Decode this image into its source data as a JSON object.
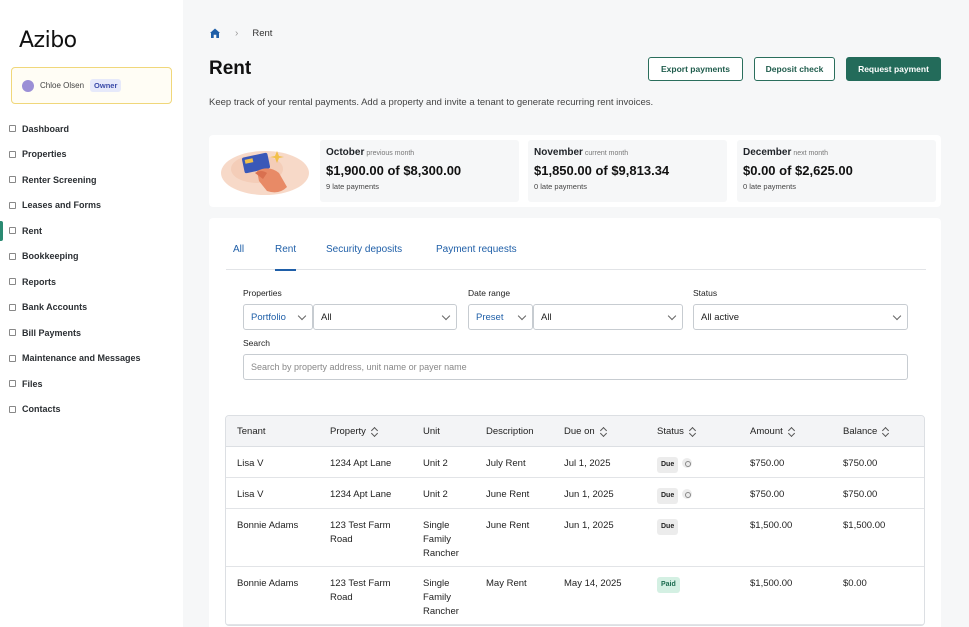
{
  "brand": {
    "logo": "Azibo"
  },
  "user": {
    "name": "Chloe Olsen",
    "role": "Owner"
  },
  "sidebar": {
    "items": [
      {
        "label": "Dashboard",
        "icon": "home-icon"
      },
      {
        "label": "Properties",
        "icon": "building-icon"
      },
      {
        "label": "Renter Screening",
        "icon": "screening-icon"
      },
      {
        "label": "Leases and Forms",
        "icon": "document-icon"
      },
      {
        "label": "Rent",
        "icon": "rent-icon",
        "active": true
      },
      {
        "label": "Bookkeeping",
        "icon": "ledger-icon"
      },
      {
        "label": "Reports",
        "icon": "report-icon"
      },
      {
        "label": "Bank Accounts",
        "icon": "bank-icon"
      },
      {
        "label": "Bill Payments",
        "icon": "bill-icon"
      },
      {
        "label": "Maintenance and Messages",
        "icon": "wrench-icon"
      },
      {
        "label": "Files",
        "icon": "folder-icon"
      },
      {
        "label": "Contacts",
        "icon": "contacts-icon"
      }
    ]
  },
  "breadcrumb": {
    "current": "Rent"
  },
  "header": {
    "title": "Rent",
    "subtitle": "Keep track of your rental payments. Add a property and invite a tenant to generate recurring rent invoices.",
    "export_label": "Export payments",
    "deposit_label": "Deposit check",
    "request_label": "Request payment"
  },
  "summary": [
    {
      "month": "October",
      "tag": "previous month",
      "amount": "$1,900.00 of $8,300.00",
      "late": "9 late payments"
    },
    {
      "month": "November",
      "tag": "current month",
      "amount": "$1,850.00 of $9,813.34",
      "late": "0 late payments"
    },
    {
      "month": "December",
      "tag": "next month",
      "amount": "$0.00 of $2,625.00",
      "late": "0 late payments"
    }
  ],
  "tabs": {
    "all": "All",
    "rent": "Rent",
    "security": "Security deposits",
    "payment_requests": "Payment requests"
  },
  "filters": {
    "properties_label": "Properties",
    "properties_scope": "Portfolio",
    "properties_value": "All",
    "date_label": "Date range",
    "date_scope": "Preset",
    "date_value": "All",
    "status_label": "Status",
    "status_value": "All active",
    "search_label": "Search",
    "search_placeholder": "Search by property address, unit name or payer name"
  },
  "table": {
    "headers": {
      "tenant": "Tenant",
      "property": "Property",
      "unit": "Unit",
      "description": "Description",
      "due": "Due on",
      "status": "Status",
      "amount": "Amount",
      "balance": "Balance"
    },
    "rows": [
      {
        "tenant": "Lisa V",
        "property": "1234 Apt Lane",
        "unit": "Unit 2",
        "description": "July Rent",
        "due": "Jul 1, 2025",
        "status": "Due",
        "amount": "$750.00",
        "balance": "$750.00"
      },
      {
        "tenant": "Lisa V",
        "property": "1234 Apt Lane",
        "unit": "Unit 2",
        "description": "June Rent",
        "due": "Jun 1, 2025",
        "status": "Due",
        "amount": "$750.00",
        "balance": "$750.00"
      },
      {
        "tenant": "Bonnie Adams",
        "property": "123 Test Farm Road",
        "unit": "Single Family Rancher",
        "description": "June Rent",
        "due": "Jun 1, 2025",
        "status": "Due",
        "amount": "$1,500.00",
        "balance": "$1,500.00"
      },
      {
        "tenant": "Bonnie Adams",
        "property": "123 Test Farm Road",
        "unit": "Single Family Rancher",
        "description": "May Rent",
        "due": "May 14, 2025",
        "status": "Paid",
        "amount": "$1,500.00",
        "balance": "$0.00"
      }
    ]
  }
}
